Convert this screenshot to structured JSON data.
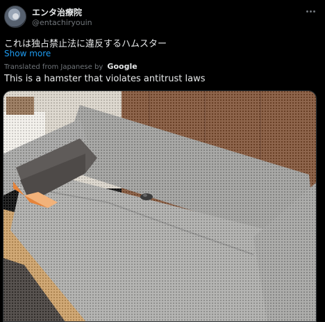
{
  "author": {
    "display_name": "エンタ治療院",
    "handle": "@entachiryouin",
    "avatar_icon": "avatar-icon"
  },
  "post": {
    "original_text": "これは独占禁止法に違反するハムスター",
    "show_more_label": "Show more",
    "translated_from_label": "Translated from Japanese by",
    "translator_brand": "Google",
    "translated_text": "This is a hamster that violates antitrust laws"
  },
  "media": {
    "kind": "photo"
  },
  "colors": {
    "background": "#000000",
    "text": "#e7e9ea",
    "secondary_text": "#71767b",
    "link": "#1d9bf0"
  }
}
